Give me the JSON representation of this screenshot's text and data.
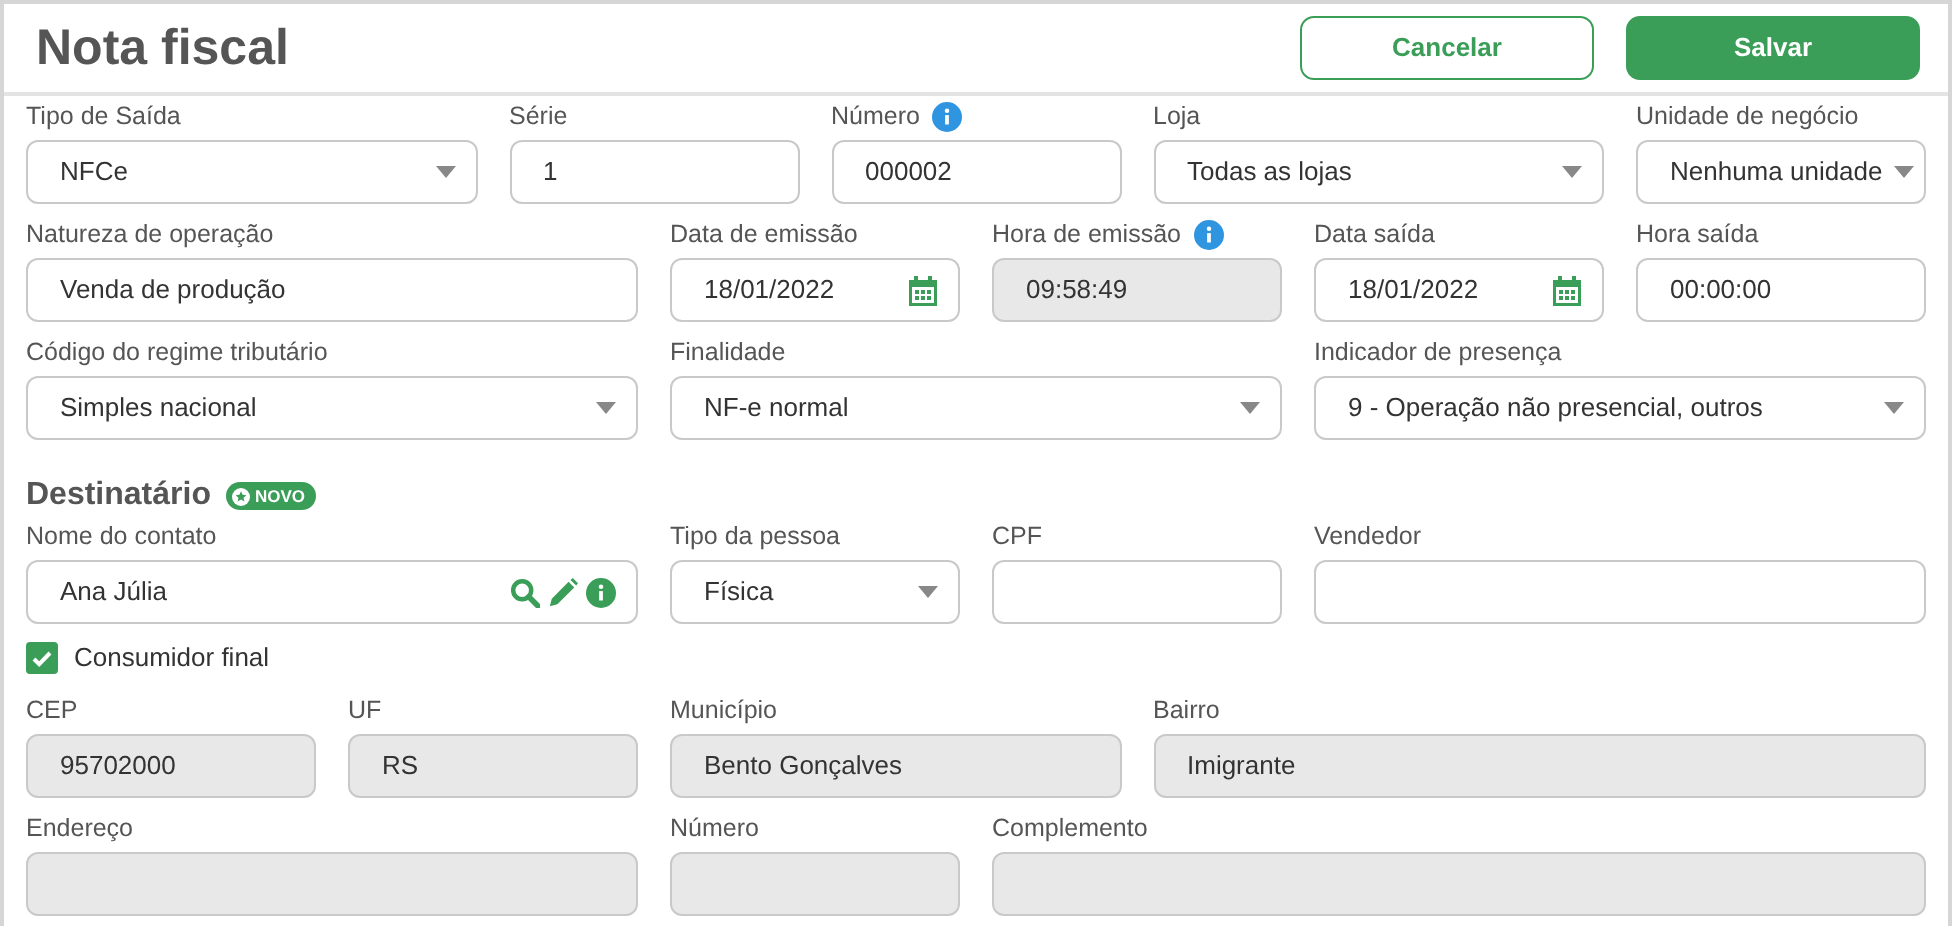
{
  "header": {
    "title": "Nota fiscal",
    "buttons": [
      {
        "label": "Cancelar",
        "kind": "outline"
      },
      {
        "label": "Salvar",
        "kind": "primary"
      }
    ]
  },
  "sections": [
    {
      "rows": [
        {
          "fields": [
            {
              "label": "Tipo de Saída",
              "value": "NFCe",
              "kind": "select",
              "disabled": false
            },
            {
              "label": "Série",
              "value": "1",
              "kind": "text",
              "disabled": false
            },
            {
              "label": "Número",
              "value": "000002",
              "kind": "text",
              "disabled": false,
              "info": true
            },
            {
              "label": "Loja",
              "value": "Todas as lojas",
              "kind": "select",
              "disabled": false
            },
            {
              "label": "Unidade de negócio",
              "value": "Nenhuma unidade",
              "kind": "select",
              "disabled": false
            }
          ]
        },
        {
          "fields": [
            {
              "label": "Natureza de operação",
              "value": "Venda de produção",
              "kind": "text",
              "disabled": false
            },
            {
              "label": "Data de emissão",
              "value": "18/01/2022",
              "kind": "date",
              "disabled": false
            },
            {
              "label": "Hora de emissão",
              "value": "09:58:49",
              "kind": "text",
              "disabled": true,
              "info": true
            },
            {
              "label": "Data saída",
              "value": "18/01/2022",
              "kind": "date",
              "disabled": false
            },
            {
              "label": "Hora saída",
              "value": "00:00:00",
              "kind": "text",
              "disabled": false
            }
          ]
        },
        {
          "fields": [
            {
              "label": "Código do regime tributário",
              "value": "Simples nacional",
              "kind": "select",
              "disabled": false
            },
            {
              "label": "Finalidade",
              "value": "NF-e normal",
              "kind": "select",
              "disabled": false
            },
            {
              "label": "Indicador de presença",
              "value": "9 - Operação não presencial, outros",
              "kind": "select",
              "disabled": false
            }
          ]
        }
      ]
    },
    {
      "title": "Destinatário",
      "badge": "NOVO",
      "rows": [
        {
          "fields": [
            {
              "label": "Nome do contato",
              "value": "Ana Júlia",
              "kind": "contact",
              "disabled": false
            },
            {
              "label": "Tipo da pessoa",
              "value": "Física",
              "kind": "select",
              "disabled": false
            },
            {
              "label": "CPF",
              "kind": "text",
              "disabled": false
            },
            {
              "label": "Vendedor",
              "kind": "text",
              "disabled": false
            }
          ]
        },
        {
          "checkbox": {
            "label": "Consumidor final",
            "checked": true
          }
        },
        {
          "fields": [
            {
              "label": "CEP",
              "value": "95702000",
              "kind": "text",
              "disabled": true
            },
            {
              "label": "UF",
              "value": "RS",
              "kind": "text",
              "disabled": true
            },
            {
              "label": "Município",
              "value": "Bento Gonçalves",
              "kind": "text",
              "disabled": true
            },
            {
              "label": "Bairro",
              "value": "Imigrante",
              "kind": "text",
              "disabled": true
            }
          ]
        },
        {
          "fields": [
            {
              "label": "Endereço",
              "kind": "text",
              "disabled": true
            },
            {
              "label": "Número",
              "kind": "text",
              "disabled": true
            },
            {
              "label": "Complemento",
              "kind": "text",
              "disabled": true
            }
          ]
        }
      ]
    }
  ]
}
